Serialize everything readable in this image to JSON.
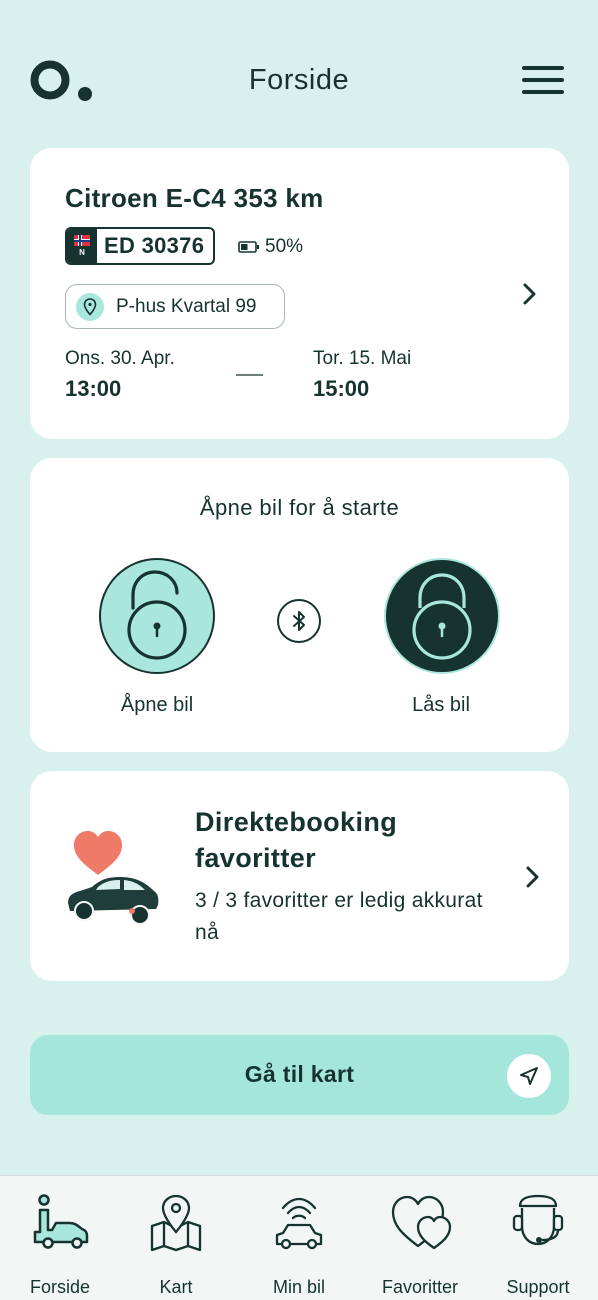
{
  "header": {
    "title": "Forside"
  },
  "booking": {
    "car_name": "Citroen E-C4 353 km",
    "plate_country": "N",
    "plate_number": "ED 30376",
    "battery": "50%",
    "battery_level": 0.5,
    "location": "P-hus Kvartal 99",
    "start_date": "Ons. 30. Apr.",
    "start_time": "13:00",
    "end_date": "Tor. 15. Mai",
    "end_time": "15:00"
  },
  "unlock": {
    "title": "Åpne bil for å starte",
    "open_label": "Åpne bil",
    "close_label": "Lås bil"
  },
  "favorites": {
    "title": "Direktebooking favoritter",
    "subtitle": "3 / 3 favoritter er ledig akkurat nå"
  },
  "map_button": {
    "label": "Gå til kart"
  },
  "nav": {
    "items": [
      {
        "label": "Forside",
        "icon": "home-car-icon"
      },
      {
        "label": "Kart",
        "icon": "map-pin-icon"
      },
      {
        "label": "Min bil",
        "icon": "my-car-icon"
      },
      {
        "label": "Favoritter",
        "icon": "hearts-icon"
      },
      {
        "label": "Support",
        "icon": "headset-icon"
      }
    ]
  },
  "colors": {
    "background": "#d8f1ec",
    "dark_green": "#16332f",
    "mint": "#a9e6dc",
    "heart": "#f07a68"
  }
}
